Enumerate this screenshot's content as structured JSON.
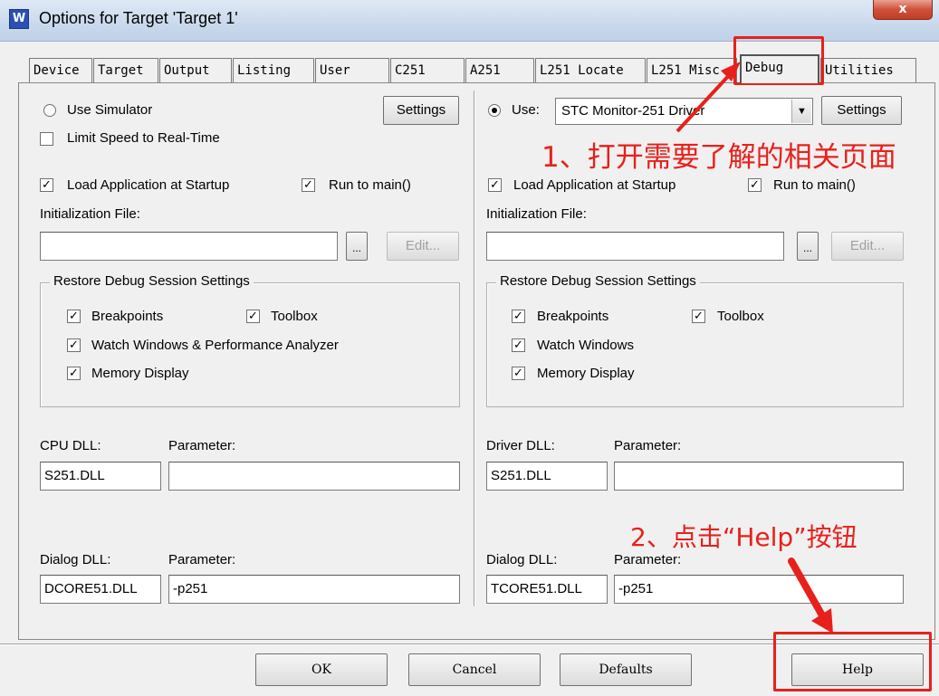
{
  "window": {
    "title": "Options for Target 'Target 1'",
    "close_label": "x"
  },
  "tabs": [
    "Device",
    "Target",
    "Output",
    "Listing",
    "User",
    "C251",
    "A251",
    "L251 Locate",
    "L251 Misc",
    "Debug",
    "Utilities"
  ],
  "active_tab": "Debug",
  "left": {
    "use_simulator": "Use Simulator",
    "settings": "Settings",
    "limit_speed": "Limit Speed to Real-Time",
    "load_app": "Load Application at Startup",
    "run_to_main": "Run to main()",
    "init_file_label": "Initialization File:",
    "browse": "...",
    "edit": "Edit...",
    "restore_title": "Restore Debug Session Settings",
    "breakpoints": "Breakpoints",
    "toolbox": "Toolbox",
    "watch": "Watch Windows & Performance Analyzer",
    "memory": "Memory Display",
    "cpu_dll_label": "CPU DLL:",
    "parameter_label": "Parameter:",
    "cpu_dll": "S251.DLL",
    "cpu_param": "",
    "dialog_dll_label": "Dialog DLL:",
    "dialog_param_label": "Parameter:",
    "dialog_dll": "DCORE51.DLL",
    "dialog_param": "-p251"
  },
  "right": {
    "use_label": "Use:",
    "driver": "STC Monitor-251 Driver",
    "settings": "Settings",
    "load_app": "Load Application at Startup",
    "run_to_main": "Run to main()",
    "init_file_label": "Initialization File:",
    "browse": "...",
    "edit": "Edit...",
    "restore_title": "Restore Debug Session Settings",
    "breakpoints": "Breakpoints",
    "toolbox": "Toolbox",
    "watch": "Watch Windows",
    "memory": "Memory Display",
    "driver_dll_label": "Driver DLL:",
    "parameter_label": "Parameter:",
    "driver_dll": "S251.DLL",
    "driver_param": "",
    "dialog_dll_label": "Dialog DLL:",
    "dialog_param_label": "Parameter:",
    "dialog_dll": "TCORE51.DLL",
    "dialog_param": "-p251"
  },
  "footer": {
    "ok": "OK",
    "cancel": "Cancel",
    "defaults": "Defaults",
    "help": "Help"
  },
  "annotations": {
    "step1": "1、打开需要了解的相关页面",
    "step2": "2、点击“Help”按钮",
    "color": "#e8201b"
  }
}
